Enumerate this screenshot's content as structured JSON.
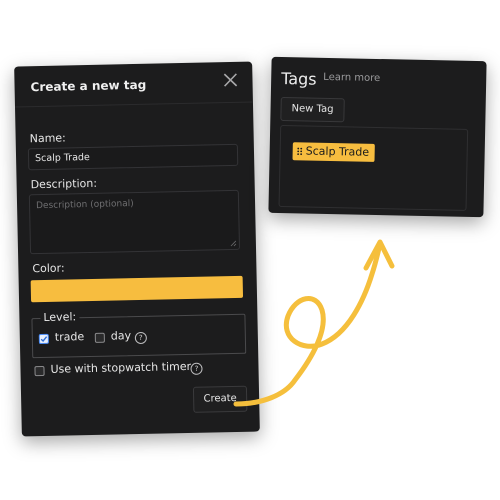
{
  "dialog": {
    "title": "Create a new tag",
    "name_label": "Name:",
    "name_value": "Scalp Trade",
    "description_label": "Description:",
    "description_placeholder": "Description (optional)",
    "color_label": "Color:",
    "color_value": "#f7bd3f",
    "level_legend": "Level:",
    "level_options": [
      {
        "label": "trade",
        "checked": true
      },
      {
        "label": "day",
        "checked": false
      }
    ],
    "help_glyph": "?",
    "stopwatch_label": "Use with stopwatch timer",
    "stopwatch_checked": false,
    "create_label": "Create"
  },
  "tags_panel": {
    "title": "Tags",
    "learn_more": "Learn more",
    "new_tag_label": "New Tag",
    "tags": [
      {
        "label": "Scalp Trade",
        "color": "#f7bd3f"
      }
    ]
  },
  "colors": {
    "accent": "#f7bd3f",
    "panel_bg": "#1c1c1d",
    "checkbox_blue": "#4c8df6"
  },
  "icons": [
    "close-icon",
    "help-icon",
    "grip-icon",
    "resize-icon",
    "hand-drawn-arrow"
  ]
}
